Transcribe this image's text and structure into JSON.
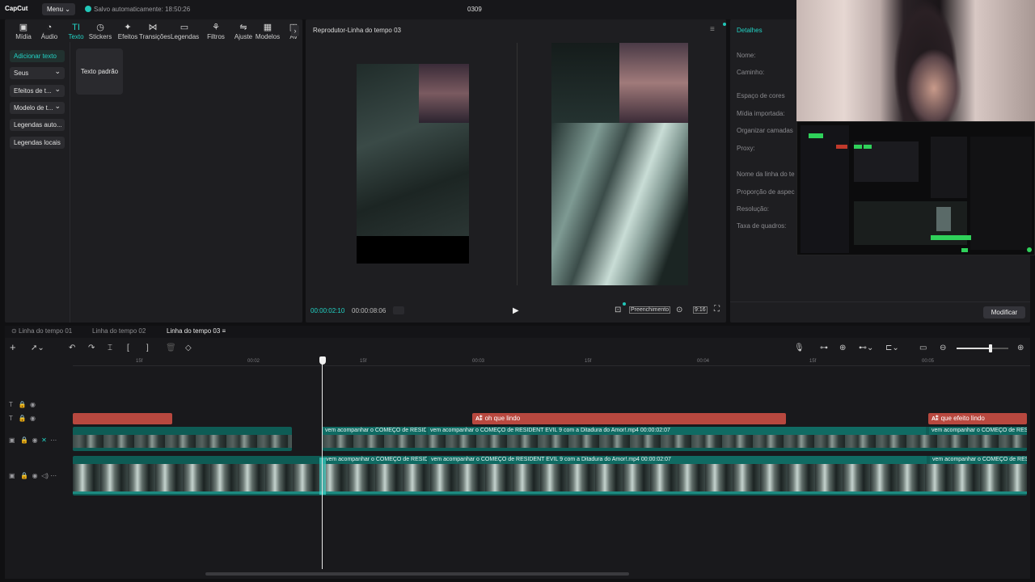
{
  "topbar": {
    "logo": "CapCut",
    "menu_label": "Menu",
    "autosave": "Salvo automaticamente: 18:50:26",
    "project_title": "0309"
  },
  "toolbar": {
    "tabs": [
      {
        "label": "Mídia",
        "icon": "media-icon"
      },
      {
        "label": "Áudio",
        "icon": "audio-icon"
      },
      {
        "label": "Texto",
        "icon": "text-icon"
      },
      {
        "label": "Stickers",
        "icon": "sticker-icon"
      },
      {
        "label": "Efeitos",
        "icon": "effects-icon"
      },
      {
        "label": "Transições",
        "icon": "transition-icon"
      },
      {
        "label": "Legendas",
        "icon": "captions-icon"
      },
      {
        "label": "Filtros",
        "icon": "filters-icon"
      },
      {
        "label": "Ajuste",
        "icon": "adjust-icon"
      },
      {
        "label": "Modelos",
        "icon": "templates-icon"
      },
      {
        "label": "Av",
        "icon": "more-icon"
      }
    ],
    "active_color": "#22d3c5"
  },
  "sidebar": {
    "items": [
      {
        "label": "Adicionar texto"
      },
      {
        "label": "Seus"
      },
      {
        "label": "Efeitos de t..."
      },
      {
        "label": "Modelo de t..."
      },
      {
        "label": "Legendas auto..."
      },
      {
        "label": "Legendas locais"
      }
    ],
    "card_label": "Texto padrão"
  },
  "player": {
    "title": "Reprodutor-Linha do tempo 03",
    "current_time": "00:00:02:10",
    "total_time": "00:00:08:06",
    "fill_label": "Preenchimento",
    "ratio_label": "9:16"
  },
  "details": {
    "title": "Detalhes",
    "labels": [
      "Nome:",
      "Caminho:",
      "Espaço de cores",
      "Mídia importada:",
      "Organizar camadas",
      "Proxy:",
      "Nome da linha do te",
      "Proporção de aspec",
      "Resolução:",
      "Taxa de quadros:"
    ],
    "modify_label": "Modificar"
  },
  "timeline": {
    "tabs": [
      "Linha do tempo 01",
      "Linha do tempo 02",
      "Linha do tempo 03"
    ],
    "ruler": [
      "15f",
      "00:02",
      "15f",
      "00:03",
      "15f",
      "00:04",
      "15f",
      "00:05"
    ],
    "text_clips": [
      "oh que lindo",
      "que efeito lindo"
    ],
    "video_label_a": "vem acompanhar o COMEÇO de RESIDENT EVIL 9 com a Ditadura do Amor!.mp4  00:00:02:07",
    "video_label_short": "vem acompanhar o COMEÇO de RESID",
    "video_label_right": "vem acompanhar o COMEÇO de RESID",
    "zoom_level": 0.65
  }
}
